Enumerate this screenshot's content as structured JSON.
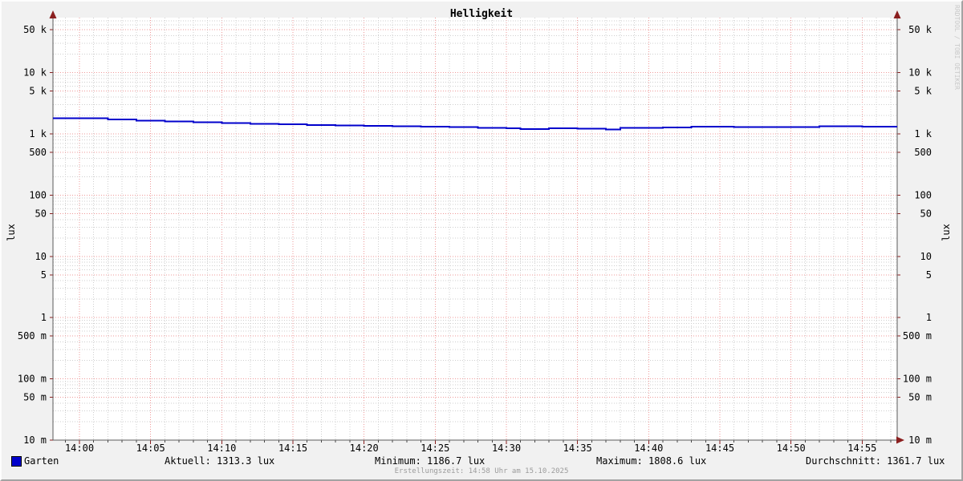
{
  "title": "Helligkeit",
  "axis": {
    "ylabel_left": "lux",
    "ylabel_right": "lux"
  },
  "watermark": "RRDTOOL / TOBI OETIKER",
  "footer": "Erstellungszeit: 14:58 Uhr am 15.10.2025",
  "legend": {
    "series_label": "Garten",
    "series_color": "#0000cc",
    "aktuell": "Aktuell: 1313.3 lux",
    "minimum": "Minimum: 1186.7 lux",
    "maximum": "Maximum: 1808.6 lux",
    "durchschnitt": "Durchschnitt: 1361.7 lux"
  },
  "colors": {
    "background": "#f1f1f1",
    "canvas": "#ffffff",
    "grid_minor": "#cfcfcf",
    "grid_major": "#ef9a9a",
    "axis": "#5a5a5a",
    "arrow": "#8b1f1f",
    "series_line": "#0000cc",
    "text": "#000000",
    "footer_text": "#9b9b9b",
    "watermark_text": "#c9c9c9"
  },
  "chart_data": {
    "type": "line",
    "title": "Helligkeit",
    "ylabel": "lux",
    "yscale": "log",
    "ylim": [
      0.01,
      75000
    ],
    "x_start": "13:58",
    "x_end": "14:58",
    "grid": "minor gray dotted (1 min / log subdivisions), major red dotted (5 min / 1-5 log steps)",
    "legend_position": "bottom",
    "x_ticks": [
      "14:00",
      "14:05",
      "14:10",
      "14:15",
      "14:20",
      "14:25",
      "14:30",
      "14:35",
      "14:40",
      "14:45",
      "14:50",
      "14:55"
    ],
    "y_ticks": [
      {
        "label": "50 k",
        "value": 50000
      },
      {
        "label": "10 k",
        "value": 10000
      },
      {
        "label": "5 k",
        "value": 5000
      },
      {
        "label": "1 k",
        "value": 1000
      },
      {
        "label": "500",
        "value": 500
      },
      {
        "label": "100",
        "value": 100
      },
      {
        "label": "50",
        "value": 50
      },
      {
        "label": "10",
        "value": 10
      },
      {
        "label": "5",
        "value": 5
      },
      {
        "label": "1",
        "value": 1
      },
      {
        "label": "500 m",
        "value": 0.5
      },
      {
        "label": "100 m",
        "value": 0.1
      },
      {
        "label": "50 m",
        "value": 0.05
      },
      {
        "label": "10 m",
        "value": 0.01
      }
    ],
    "series": [
      {
        "name": "Garten",
        "color": "#0000cc",
        "style": "step",
        "points": [
          {
            "t": "13:58",
            "v": 1808.6
          },
          {
            "t": "14:02",
            "v": 1725
          },
          {
            "t": "14:04",
            "v": 1655
          },
          {
            "t": "14:06",
            "v": 1590
          },
          {
            "t": "14:08",
            "v": 1540
          },
          {
            "t": "14:10",
            "v": 1505
          },
          {
            "t": "14:12",
            "v": 1465
          },
          {
            "t": "14:14",
            "v": 1430
          },
          {
            "t": "14:16",
            "v": 1400
          },
          {
            "t": "14:18",
            "v": 1372
          },
          {
            "t": "14:20",
            "v": 1352
          },
          {
            "t": "14:22",
            "v": 1335
          },
          {
            "t": "14:24",
            "v": 1316
          },
          {
            "t": "14:26",
            "v": 1292
          },
          {
            "t": "14:28",
            "v": 1248
          },
          {
            "t": "14:30",
            "v": 1232
          },
          {
            "t": "14:31",
            "v": 1196
          },
          {
            "t": "14:33",
            "v": 1228
          },
          {
            "t": "14:35",
            "v": 1212
          },
          {
            "t": "14:37",
            "v": 1186.7
          },
          {
            "t": "14:38",
            "v": 1252
          },
          {
            "t": "14:41",
            "v": 1272
          },
          {
            "t": "14:43",
            "v": 1307
          },
          {
            "t": "14:46",
            "v": 1300
          },
          {
            "t": "14:49",
            "v": 1288
          },
          {
            "t": "14:52",
            "v": 1327
          },
          {
            "t": "14:55",
            "v": 1320
          },
          {
            "t": "14:57",
            "v": 1313.3
          }
        ]
      }
    ],
    "stats": {
      "aktuell": 1313.3,
      "minimum": 1186.7,
      "maximum": 1808.6,
      "durchschnitt": 1361.7,
      "unit": "lux"
    }
  }
}
